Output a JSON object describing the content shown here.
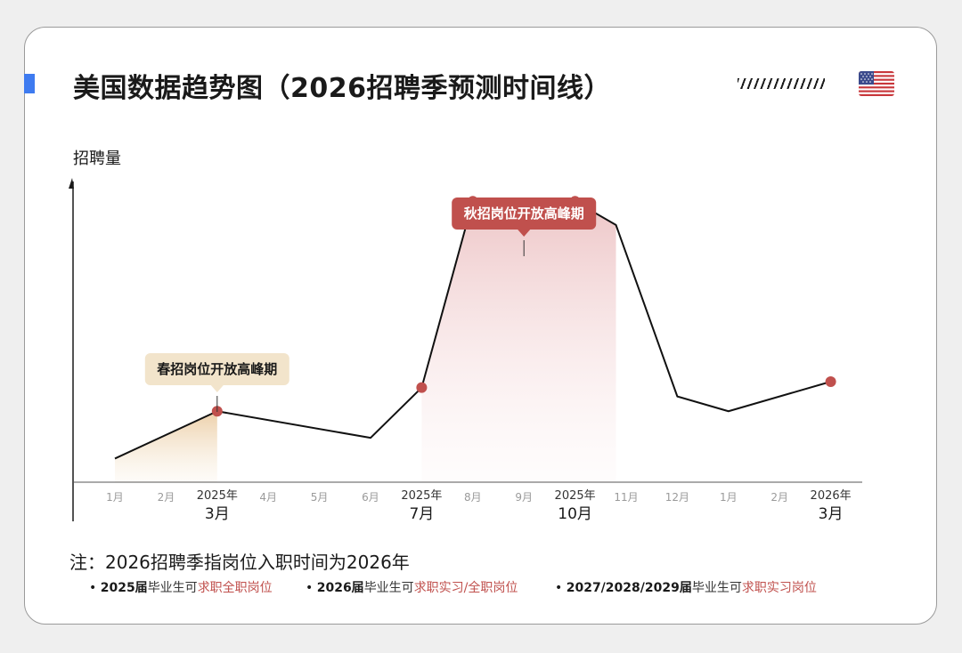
{
  "title": "美国数据趋势图（2026招聘季预测时间线）",
  "colors": {
    "accent": "#3e7bf0",
    "peak_red": "#c0504d",
    "spring_beige": "#f2e4cb"
  },
  "icons": {
    "flag": "us-flag-icon",
    "decoration": "hatch-lines-icon"
  },
  "chart_data": {
    "type": "line",
    "ylabel": "招聘量",
    "x_ticks": [
      {
        "top": "",
        "main": "1月"
      },
      {
        "top": "",
        "main": "2月"
      },
      {
        "top": "2025年",
        "main": "3月"
      },
      {
        "top": "",
        "main": "4月"
      },
      {
        "top": "",
        "main": "5月"
      },
      {
        "top": "",
        "main": "6月"
      },
      {
        "top": "2025年",
        "main": "7月"
      },
      {
        "top": "",
        "main": "8月"
      },
      {
        "top": "",
        "main": "9月"
      },
      {
        "top": "2025年",
        "main": "10月"
      },
      {
        "top": "",
        "main": "11月"
      },
      {
        "top": "",
        "main": "12月"
      },
      {
        "top": "",
        "main": "1月"
      },
      {
        "top": "",
        "main": "2月"
      },
      {
        "top": "2026年",
        "main": "3月"
      }
    ],
    "series": [
      {
        "points": [
          {
            "x": 0.0,
            "y": 8
          },
          {
            "x": 2.0,
            "y": 24
          },
          {
            "x": 5.0,
            "y": 15
          },
          {
            "x": 6.0,
            "y": 32
          },
          {
            "x": 7.0,
            "y": 95
          },
          {
            "x": 9.0,
            "y": 95
          },
          {
            "x": 9.8,
            "y": 87
          },
          {
            "x": 11.0,
            "y": 29
          },
          {
            "x": 12.0,
            "y": 24
          },
          {
            "x": 14.0,
            "y": 34
          }
        ]
      }
    ],
    "markers_at_x": [
      2.0,
      6.0,
      7.0,
      9.0,
      14.0
    ],
    "shaded_regions": [
      {
        "from": 0.0,
        "to": 2.0,
        "color": "beige"
      },
      {
        "from": 6.0,
        "to": 9.8,
        "color": "red"
      }
    ],
    "annotations": [
      {
        "text": "春招岗位开放高峰期",
        "x": 2.0,
        "style": "beige"
      },
      {
        "text": "秋招岗位开放高峰期",
        "x": 8.0,
        "style": "red"
      }
    ],
    "ylim": [
      0,
      130
    ]
  },
  "note": "注：2026招聘季指岗位入职时间为2026年",
  "legend": [
    {
      "bullet": "•",
      "bold": "2025届",
      "plain": "毕业生可",
      "highlight": "求职全职岗位"
    },
    {
      "bullet": "•",
      "bold": "2026届",
      "plain": "毕业生可",
      "highlight": "求职实习/全职岗位"
    },
    {
      "bullet": "•",
      "bold": "2027/2028/2029届",
      "plain": "毕业生可",
      "highlight": "求职实习岗位"
    }
  ]
}
